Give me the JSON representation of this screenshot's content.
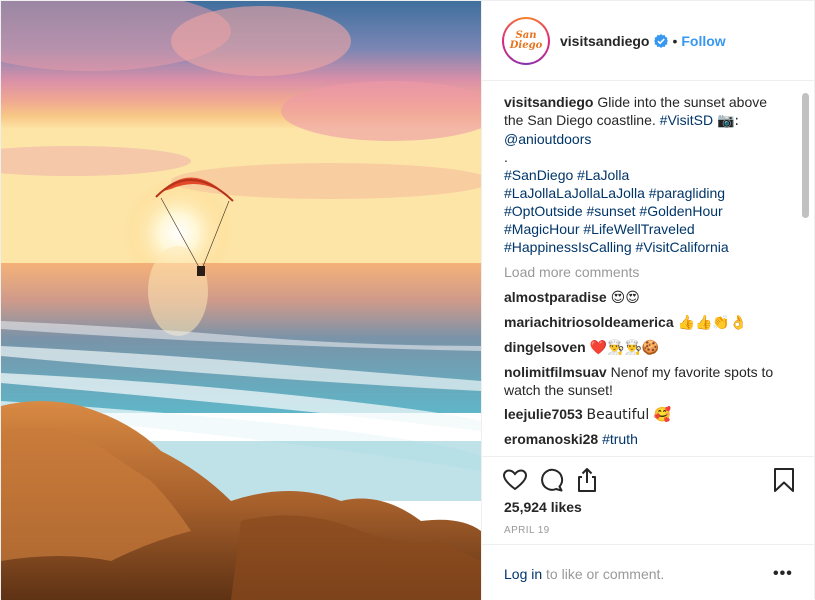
{
  "header": {
    "avatar_text": "San Diego",
    "username": "visitsandiego",
    "separator": "•",
    "follow_label": "Follow"
  },
  "caption": {
    "username": "visitsandiego",
    "text_1": "Glide into the sunset above the San Diego coastline.",
    "tag_1": "#VisitSD",
    "camera": "📷:",
    "mention": "@anioutdoors",
    "dot": ".",
    "tags_line_1": "#SanDiego #LaJolla",
    "tags_line_2": "#LaJollaLaJollaLaJolla #paragliding",
    "tags_line_3": "#OptOutside #sunset #GoldenHour",
    "tags_line_4": "#MagicHour #LifeWellTraveled",
    "tags_line_5": "#HappinessIsCalling #VisitCalifornia"
  },
  "load_more_label": "Load more comments",
  "comments": [
    {
      "user": "almostparadise",
      "text": "😍😍"
    },
    {
      "user": "mariachitriosoldeamerica",
      "text": "👍👍👏👌"
    },
    {
      "user": "dingelsoven",
      "text": "❤️👨‍🍳👨‍🍳🍪"
    },
    {
      "user": "nolimitfilmsuav",
      "text": "Nenof my favorite spots to watch the sunset!"
    },
    {
      "user": "leejulie7053",
      "text": "Beautiful 🥰"
    },
    {
      "user": "eromanoski28",
      "text": "#truth"
    }
  ],
  "actions": {
    "like_icon": "heart-icon",
    "comment_icon": "comment-icon",
    "share_icon": "share-icon",
    "save_icon": "bookmark-icon"
  },
  "likes": "25,924 likes",
  "date": "APRIL 19",
  "login": {
    "link": "Log in",
    "rest": " to like or comment."
  },
  "more_label": "•••",
  "colors": {
    "link_blue": "#3897f0",
    "tag_navy": "#003569",
    "muted": "#999999",
    "verified": "#3897f0"
  }
}
